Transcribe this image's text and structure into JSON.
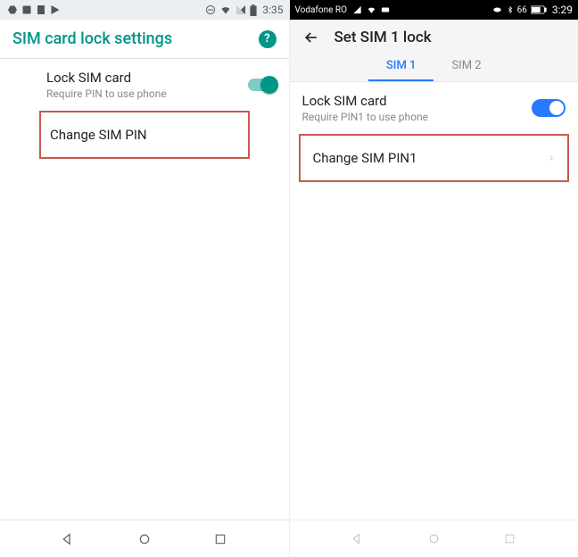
{
  "left": {
    "status": {
      "time": "3:35"
    },
    "header": {
      "title": "SIM card lock settings"
    },
    "lock_row": {
      "label": "Lock SIM card",
      "sub": "Require PIN to use phone"
    },
    "change_row": {
      "label": "Change SIM PIN"
    }
  },
  "right": {
    "status": {
      "carrier": "Vodafone RO",
      "battery": "66",
      "time": "3:29"
    },
    "header": {
      "title": "Set SIM 1 lock"
    },
    "tabs": {
      "sim1": "SIM 1",
      "sim2": "SIM 2"
    },
    "lock_row": {
      "label": "Lock SIM card",
      "sub": "Require PIN1 to use phone"
    },
    "change_row": {
      "label": "Change SIM PIN1"
    }
  }
}
